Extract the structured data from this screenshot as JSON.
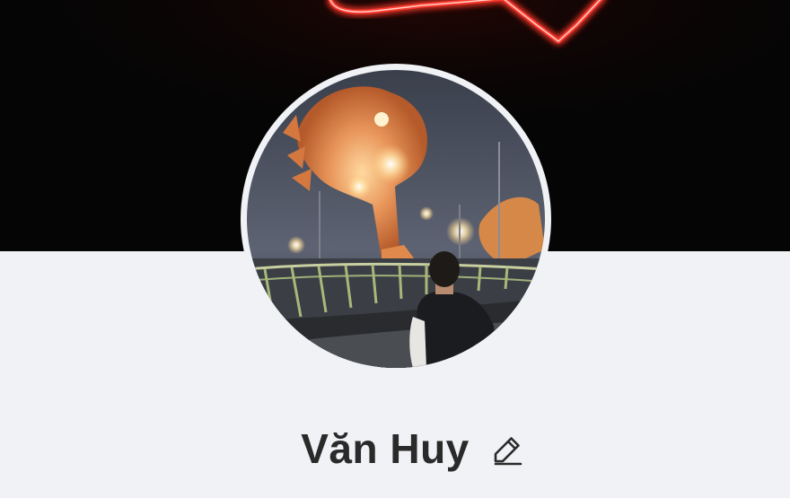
{
  "profile": {
    "name": "Văn Huy"
  },
  "cover": {
    "neon_color": "#ff3b2f",
    "background_color": "#050505"
  },
  "avatar": {
    "ring_color": "#f0f2f5"
  },
  "icons": {
    "edit": "pencil-icon"
  }
}
